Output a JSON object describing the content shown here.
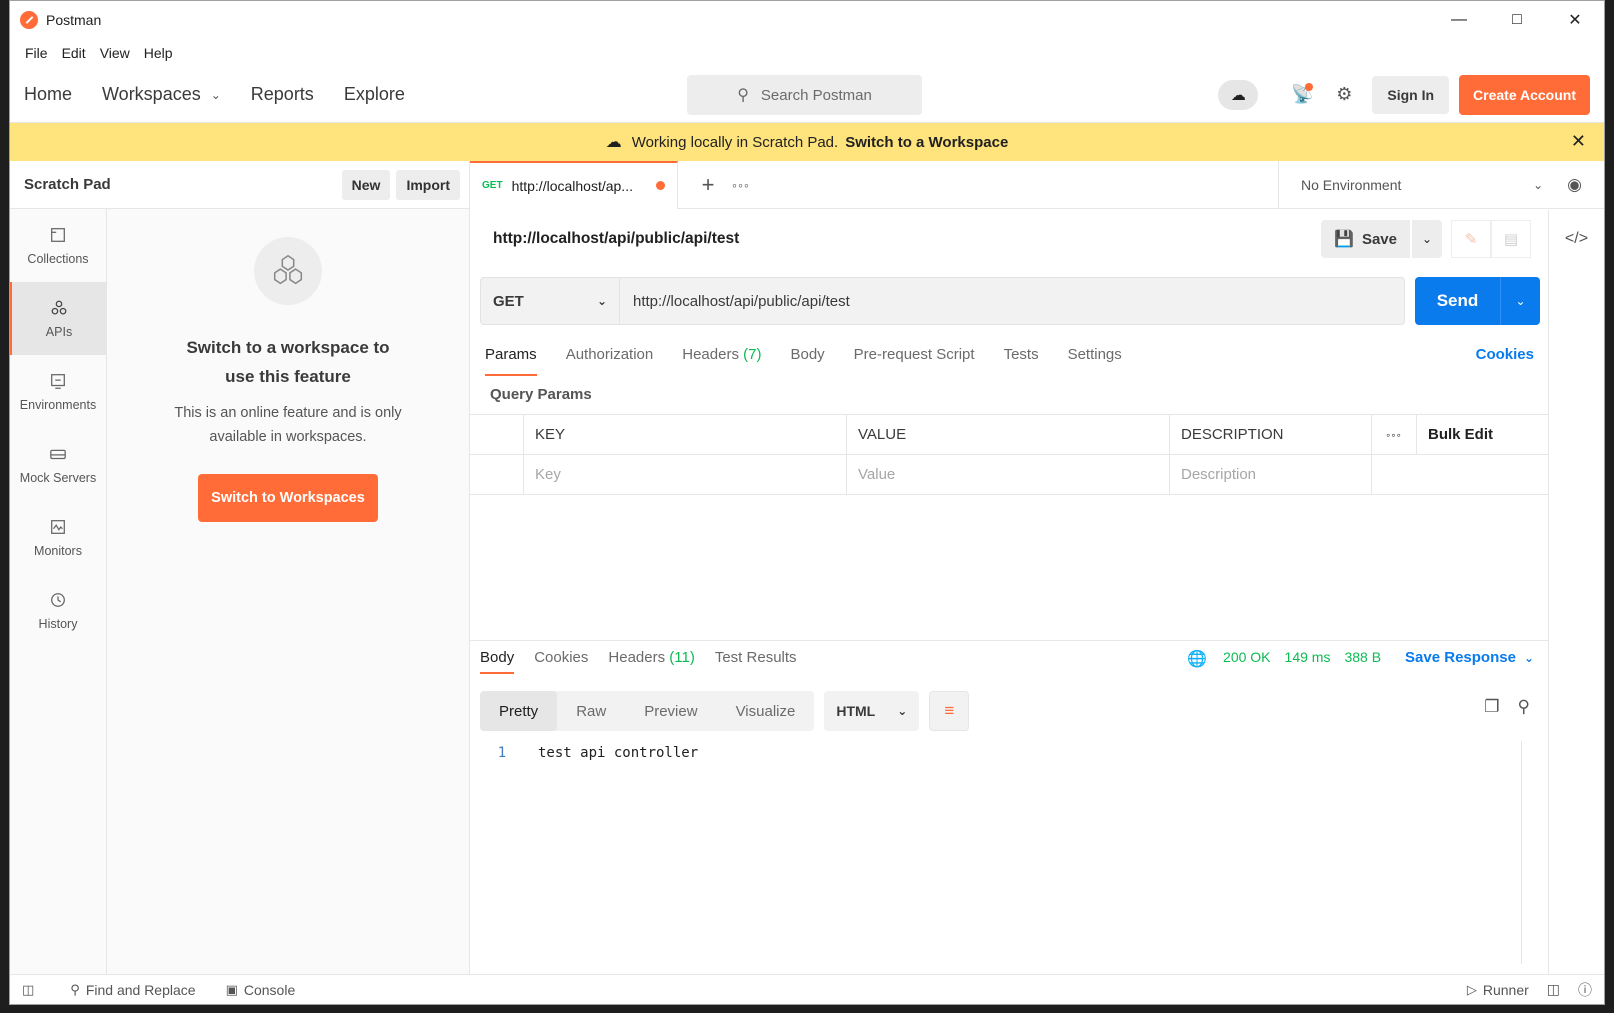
{
  "window": {
    "title": "Postman"
  },
  "menu": [
    "File",
    "Edit",
    "View",
    "Help"
  ],
  "header": {
    "nav": [
      "Home",
      "Workspaces",
      "Reports",
      "Explore"
    ],
    "search_placeholder": "Search Postman",
    "sign_in": "Sign In",
    "create_account": "Create Account"
  },
  "banner": {
    "text": "Working locally in Scratch Pad.",
    "link": "Switch to a Workspace"
  },
  "sidebar": {
    "title": "Scratch Pad",
    "new_label": "New",
    "import_label": "Import",
    "rail": [
      {
        "label": "Collections",
        "icon": "collections-icon"
      },
      {
        "label": "APIs",
        "icon": "apis-icon"
      },
      {
        "label": "Environments",
        "icon": "environments-icon"
      },
      {
        "label": "Mock Servers",
        "icon": "mock-servers-icon"
      },
      {
        "label": "Monitors",
        "icon": "monitors-icon"
      },
      {
        "label": "History",
        "icon": "history-icon"
      }
    ],
    "active_rail": "APIs",
    "empty": {
      "title": "Switch to a workspace to use this feature",
      "text": "This is an online feature and is only available in workspaces.",
      "button": "Switch to Workspaces"
    }
  },
  "tab": {
    "method": "GET",
    "label": "http://localhost/ap..."
  },
  "environment": {
    "label": "No Environment"
  },
  "request": {
    "title": "http://localhost/api/public/api/test",
    "save_label": "Save",
    "method": "GET",
    "url": "http://localhost/api/public/api/test",
    "send_label": "Send",
    "tabs": [
      {
        "label": "Params",
        "count": ""
      },
      {
        "label": "Authorization",
        "count": ""
      },
      {
        "label": "Headers",
        "count": "(7)"
      },
      {
        "label": "Body",
        "count": ""
      },
      {
        "label": "Pre-request Script",
        "count": ""
      },
      {
        "label": "Tests",
        "count": ""
      },
      {
        "label": "Settings",
        "count": ""
      }
    ],
    "cookies_label": "Cookies",
    "query_params_title": "Query Params",
    "table": {
      "headers": [
        "KEY",
        "VALUE",
        "DESCRIPTION"
      ],
      "bulk_edit": "Bulk Edit",
      "placeholders": [
        "Key",
        "Value",
        "Description"
      ]
    }
  },
  "response": {
    "tabs": [
      {
        "label": "Body",
        "count": ""
      },
      {
        "label": "Cookies",
        "count": ""
      },
      {
        "label": "Headers",
        "count": "(11)"
      },
      {
        "label": "Test Results",
        "count": ""
      }
    ],
    "status": "200 OK",
    "time": "149 ms",
    "size": "388 B",
    "save_response": "Save Response",
    "formats": [
      "Pretty",
      "Raw",
      "Preview",
      "Visualize"
    ],
    "language": "HTML",
    "lines": [
      {
        "num": "1",
        "text": "test api controller"
      }
    ]
  },
  "statusbar": {
    "find_replace": "Find and Replace",
    "console": "Console",
    "runner": "Runner"
  },
  "colors": {
    "accent": "#ff6c37",
    "primary": "#097bed",
    "success": "#0cbb52",
    "banner": "#ffe47e"
  }
}
